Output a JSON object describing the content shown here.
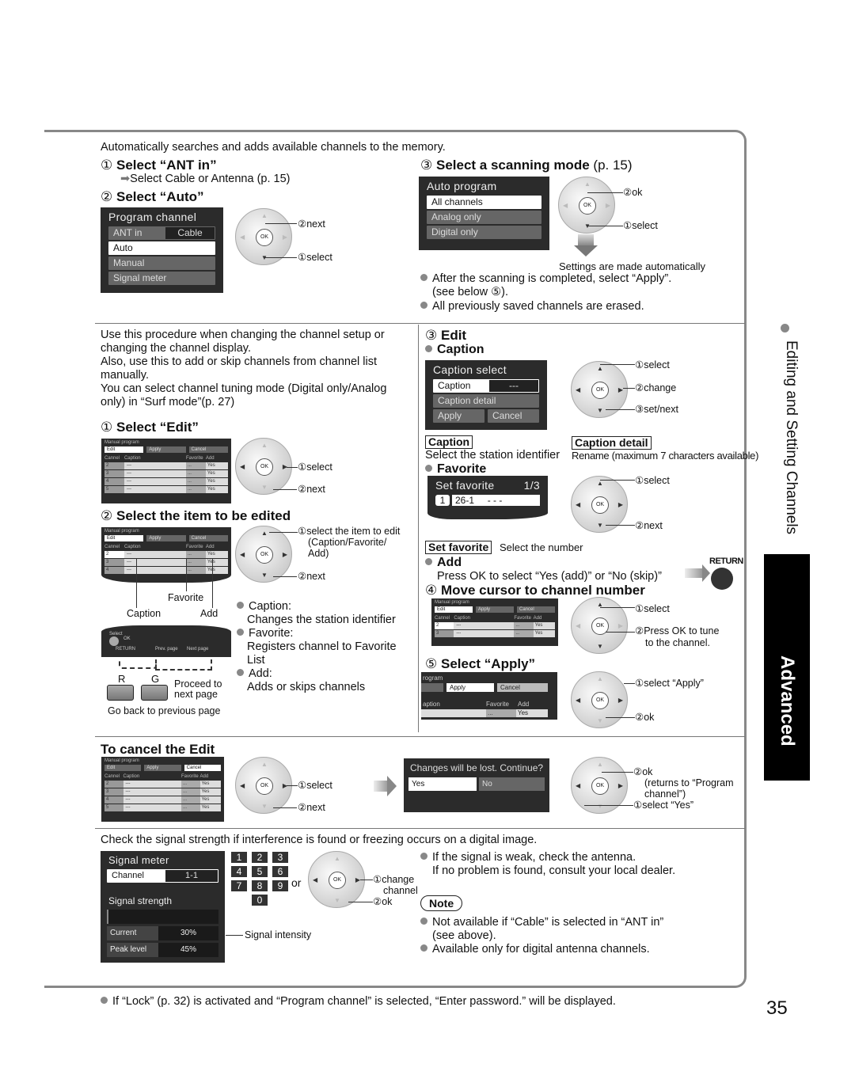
{
  "page": {
    "number": "35",
    "side_title": "Editing and Setting Channels",
    "side_tab": "Advanced"
  },
  "auto": {
    "intro": "Automatically searches and adds available channels to the memory.",
    "step1": {
      "num": "①",
      "title": "Select “ANT in”",
      "sub": "Select Cable or Antenna (p. 15)"
    },
    "step2": {
      "num": "②",
      "title": "Select “Auto”"
    },
    "program_menu": {
      "title": "Program channel",
      "items": [
        {
          "label": "ANT in",
          "value": "Cable"
        },
        {
          "label": "Auto"
        },
        {
          "label": "Manual"
        },
        {
          "label": "Signal meter"
        }
      ]
    },
    "dpad1": {
      "next": "②next",
      "select": "①select"
    },
    "step3": {
      "num": "③",
      "title": "Select a scanning mode",
      "ref": "(p. 15)"
    },
    "auto_menu": {
      "title": "Auto program",
      "items": [
        "All channels",
        "Analog only",
        "Digital only"
      ]
    },
    "dpad2": {
      "ok": "②ok",
      "select": "①select"
    },
    "auto_note": "Settings are made automatically",
    "bullets": [
      "After the scanning is completed, select “Apply”.",
      "(see below ⑤).",
      "All previously saved channels are erased."
    ]
  },
  "manual": {
    "intro": [
      "Use this procedure when changing the channel setup or",
      "changing the channel display.",
      "Also, use this to add or skip channels from channel list",
      "manually.",
      "You can select channel tuning mode (Digital only/Analog",
      "only) in “Surf mode”(p. 27)"
    ],
    "step1": {
      "num": "①",
      "title": "Select “Edit”",
      "select": "①select",
      "next": "②next"
    },
    "table": {
      "title": "Manual program",
      "buttons": [
        "Edit",
        "Apply",
        "Cancel"
      ],
      "headers": [
        "Cannel",
        "Caption",
        "Favorite",
        "Add"
      ],
      "rows": [
        [
          "2",
          "---",
          "...",
          "Yes"
        ],
        [
          "3",
          "---",
          "...",
          "Yes"
        ],
        [
          "4",
          "---",
          "...",
          "Yes"
        ],
        [
          "5",
          "---",
          "...",
          "Yes"
        ]
      ]
    },
    "step2": {
      "num": "②",
      "title": "Select the item to be edited",
      "select": "①select the item to edit",
      "select2": "(Caption/Favorite/",
      "select3": "Add)",
      "next": "②next",
      "labels": {
        "favorite": "Favorite",
        "caption": "Caption",
        "add": "Add"
      },
      "footer": {
        "select": "Select",
        "ok": "OK",
        "return": "RETURN",
        "prev": "Prev. page",
        "next": "Next page"
      },
      "keys": {
        "r": "R",
        "g": "G",
        "proceed1": "Proceed to",
        "proceed2": "next page",
        "back": "Go back to previous page"
      },
      "bullets": [
        {
          "title": "Caption:",
          "desc": "Changes the station identifier"
        },
        {
          "title": "Favorite:",
          "desc": "Registers channel to Favorite",
          "desc2": "List"
        },
        {
          "title": "Add:",
          "desc": "Adds or skips channels"
        }
      ]
    },
    "step3": {
      "num": "③",
      "title": "Edit",
      "caption_head": "Caption",
      "caption_menu": {
        "title": "Caption select",
        "caption": "Caption",
        "value": "---",
        "detail": "Caption detail",
        "apply": "Apply",
        "cancel": "Cancel"
      },
      "dpad": {
        "select": "①select",
        "change": "②change",
        "setnext": "③set/next"
      },
      "caption_box": "Caption",
      "caption_desc": "Select the station identifier",
      "detail_box": "Caption detail",
      "detail_desc": "Rename (maximum 7 characters available)",
      "favorite_head": "Favorite",
      "fav_menu": {
        "title": "Set favorite",
        "page": "1/3",
        "num": "1",
        "value": "26-1",
        "dashes": "- - -"
      },
      "fav_dpad": {
        "select": "①select",
        "next": "②next"
      },
      "setfav_box": "Set favorite",
      "setfav_desc": "Select the number",
      "add_head": "Add",
      "add_desc": "Press OK to select “Yes (add)” or “No (skip)”",
      "return_label": "RETURN"
    },
    "step4": {
      "num": "④",
      "title": "Move cursor to channel number",
      "select": "①select",
      "ok1": "②Press OK to tune",
      "ok2": "to the channel."
    },
    "step5": {
      "num": "⑤",
      "title": "Select “Apply”",
      "select": "①select “Apply”",
      "ok": "②ok",
      "crop": {
        "title": "rogram",
        "apply": "Apply",
        "cancel": "Cancel",
        "caption": "aption",
        "favorite": "Favorite",
        "add": "Add",
        "yes": "Yes",
        "dots": "..."
      }
    }
  },
  "cancel": {
    "title": "To cancel the Edit",
    "select": "①select",
    "next": "②next",
    "dialog": {
      "text": "Changes will be lost. Continue?",
      "yes": "Yes",
      "no": "No"
    },
    "ok": "②ok",
    "ret1": "(returns to “Program",
    "ret2": "channel”)",
    "select_yes": "①select “Yes”"
  },
  "signal": {
    "intro": "Check the signal strength if interference is found or freezing occurs on a digital image.",
    "menu": {
      "title": "Signal  meter",
      "channel": "Channel",
      "channel_value": "1-1",
      "strength": "Signal  strength",
      "current": "Current",
      "current_value": "30%",
      "peak": "Peak level",
      "peak_value": "45%"
    },
    "keys": [
      "1",
      "2",
      "3",
      "4",
      "5",
      "6",
      "7",
      "8",
      "9",
      "0"
    ],
    "or": "or",
    "change1": "①change",
    "change2": "channel",
    "ok": "②ok",
    "intensity": "Signal intensity",
    "bullets": [
      "If the signal is weak, check the antenna.",
      "If no problem is found, consult your local dealer."
    ],
    "note": "Note",
    "note_bullets": [
      "Not available if “Cable” is selected in “ANT in”",
      "(see above).",
      "Available only for digital antenna channels."
    ]
  },
  "footer_note": "If “Lock” (p. 32) is activated and “Program channel” is selected, “Enter password.” will be displayed."
}
